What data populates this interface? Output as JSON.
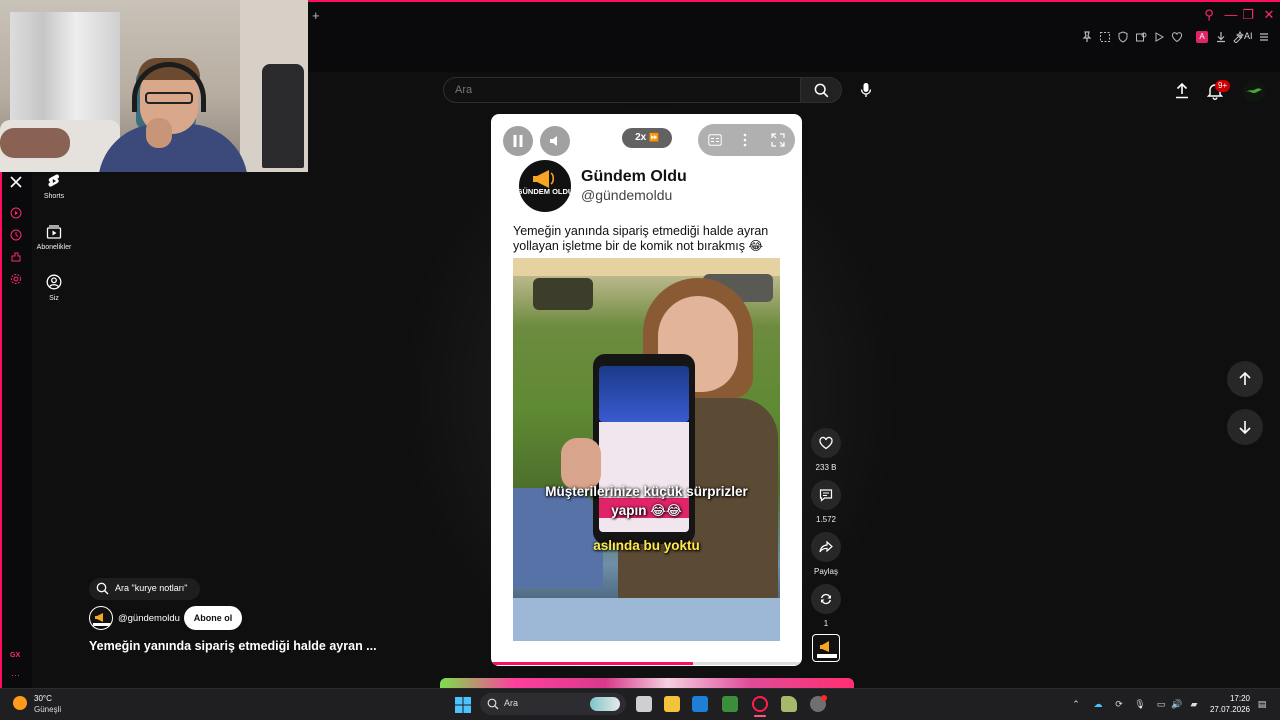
{
  "browser": {
    "new_tab": "+",
    "window_controls": [
      "⚲",
      "—",
      "❐",
      "✕"
    ],
    "toolbar_icons": [
      "pin-icon",
      "snapshot-icon",
      "shield-icon",
      "ext-icon",
      "play-icon",
      "heart-icon",
      "profile-icon",
      "download-icon",
      "aria-icon",
      "menu-icon"
    ],
    "ai_label": "AI",
    "sidebar_gx_label": "GX"
  },
  "youtube_nav": {
    "items": [
      {
        "label": "Shorts",
        "icon": "shorts-icon"
      },
      {
        "label": "Abonelikler",
        "icon": "subscriptions-icon"
      },
      {
        "label": "Siz",
        "icon": "you-icon"
      }
    ]
  },
  "search": {
    "placeholder": "Ara"
  },
  "header": {
    "notification_badge": "9+"
  },
  "short": {
    "speed": "2x",
    "channel_name": "Gündem Oldu",
    "channel_handle": "@gündemoldu",
    "logo_text": "GÜNDEM OLDU",
    "caption": "Yemeğin yanında sipariş etmediği halde ayran yollayan işletme bir de komik not bırakmış 😂",
    "subtitle_line1": "Müşterilerinize küçük sürprizler",
    "subtitle_line2": "yapın 😂😂",
    "subtitle_line3": "aslında bu yoktu",
    "progress": 0.65
  },
  "actions": {
    "like_count": "233 B",
    "comment_count": "1.572",
    "share_label": "Paylaş",
    "remix_count": "1"
  },
  "meta": {
    "suggestion": "Ara \"kurye notları\"",
    "handle": "@gündemoldu",
    "subscribe_label": "Abone ol",
    "title": "Yemeğin yanında sipariş etmediği halde ayran ..."
  },
  "taskbar": {
    "weather_temp": "30°C",
    "weather_desc": "Güneşli",
    "search_label": "Ara",
    "time": "17:20",
    "date": "27.07.2026"
  },
  "colors": {
    "gx_accent": "#ff0f5b",
    "progress": "#ff0f5b",
    "badge": "#cc0000"
  }
}
